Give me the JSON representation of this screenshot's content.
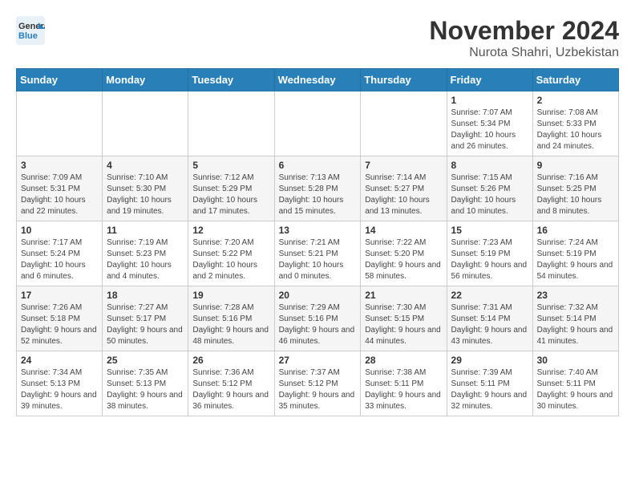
{
  "logo": {
    "line1": "General",
    "line2": "Blue"
  },
  "title": "November 2024",
  "location": "Nurota Shahri, Uzbekistan",
  "days_of_week": [
    "Sunday",
    "Monday",
    "Tuesday",
    "Wednesday",
    "Thursday",
    "Friday",
    "Saturday"
  ],
  "weeks": [
    [
      {
        "day": "",
        "info": ""
      },
      {
        "day": "",
        "info": ""
      },
      {
        "day": "",
        "info": ""
      },
      {
        "day": "",
        "info": ""
      },
      {
        "day": "",
        "info": ""
      },
      {
        "day": "1",
        "info": "Sunrise: 7:07 AM\nSunset: 5:34 PM\nDaylight: 10 hours and 26 minutes."
      },
      {
        "day": "2",
        "info": "Sunrise: 7:08 AM\nSunset: 5:33 PM\nDaylight: 10 hours and 24 minutes."
      }
    ],
    [
      {
        "day": "3",
        "info": "Sunrise: 7:09 AM\nSunset: 5:31 PM\nDaylight: 10 hours and 22 minutes."
      },
      {
        "day": "4",
        "info": "Sunrise: 7:10 AM\nSunset: 5:30 PM\nDaylight: 10 hours and 19 minutes."
      },
      {
        "day": "5",
        "info": "Sunrise: 7:12 AM\nSunset: 5:29 PM\nDaylight: 10 hours and 17 minutes."
      },
      {
        "day": "6",
        "info": "Sunrise: 7:13 AM\nSunset: 5:28 PM\nDaylight: 10 hours and 15 minutes."
      },
      {
        "day": "7",
        "info": "Sunrise: 7:14 AM\nSunset: 5:27 PM\nDaylight: 10 hours and 13 minutes."
      },
      {
        "day": "8",
        "info": "Sunrise: 7:15 AM\nSunset: 5:26 PM\nDaylight: 10 hours and 10 minutes."
      },
      {
        "day": "9",
        "info": "Sunrise: 7:16 AM\nSunset: 5:25 PM\nDaylight: 10 hours and 8 minutes."
      }
    ],
    [
      {
        "day": "10",
        "info": "Sunrise: 7:17 AM\nSunset: 5:24 PM\nDaylight: 10 hours and 6 minutes."
      },
      {
        "day": "11",
        "info": "Sunrise: 7:19 AM\nSunset: 5:23 PM\nDaylight: 10 hours and 4 minutes."
      },
      {
        "day": "12",
        "info": "Sunrise: 7:20 AM\nSunset: 5:22 PM\nDaylight: 10 hours and 2 minutes."
      },
      {
        "day": "13",
        "info": "Sunrise: 7:21 AM\nSunset: 5:21 PM\nDaylight: 10 hours and 0 minutes."
      },
      {
        "day": "14",
        "info": "Sunrise: 7:22 AM\nSunset: 5:20 PM\nDaylight: 9 hours and 58 minutes."
      },
      {
        "day": "15",
        "info": "Sunrise: 7:23 AM\nSunset: 5:19 PM\nDaylight: 9 hours and 56 minutes."
      },
      {
        "day": "16",
        "info": "Sunrise: 7:24 AM\nSunset: 5:19 PM\nDaylight: 9 hours and 54 minutes."
      }
    ],
    [
      {
        "day": "17",
        "info": "Sunrise: 7:26 AM\nSunset: 5:18 PM\nDaylight: 9 hours and 52 minutes."
      },
      {
        "day": "18",
        "info": "Sunrise: 7:27 AM\nSunset: 5:17 PM\nDaylight: 9 hours and 50 minutes."
      },
      {
        "day": "19",
        "info": "Sunrise: 7:28 AM\nSunset: 5:16 PM\nDaylight: 9 hours and 48 minutes."
      },
      {
        "day": "20",
        "info": "Sunrise: 7:29 AM\nSunset: 5:16 PM\nDaylight: 9 hours and 46 minutes."
      },
      {
        "day": "21",
        "info": "Sunrise: 7:30 AM\nSunset: 5:15 PM\nDaylight: 9 hours and 44 minutes."
      },
      {
        "day": "22",
        "info": "Sunrise: 7:31 AM\nSunset: 5:14 PM\nDaylight: 9 hours and 43 minutes."
      },
      {
        "day": "23",
        "info": "Sunrise: 7:32 AM\nSunset: 5:14 PM\nDaylight: 9 hours and 41 minutes."
      }
    ],
    [
      {
        "day": "24",
        "info": "Sunrise: 7:34 AM\nSunset: 5:13 PM\nDaylight: 9 hours and 39 minutes."
      },
      {
        "day": "25",
        "info": "Sunrise: 7:35 AM\nSunset: 5:13 PM\nDaylight: 9 hours and 38 minutes."
      },
      {
        "day": "26",
        "info": "Sunrise: 7:36 AM\nSunset: 5:12 PM\nDaylight: 9 hours and 36 minutes."
      },
      {
        "day": "27",
        "info": "Sunrise: 7:37 AM\nSunset: 5:12 PM\nDaylight: 9 hours and 35 minutes."
      },
      {
        "day": "28",
        "info": "Sunrise: 7:38 AM\nSunset: 5:11 PM\nDaylight: 9 hours and 33 minutes."
      },
      {
        "day": "29",
        "info": "Sunrise: 7:39 AM\nSunset: 5:11 PM\nDaylight: 9 hours and 32 minutes."
      },
      {
        "day": "30",
        "info": "Sunrise: 7:40 AM\nSunset: 5:11 PM\nDaylight: 9 hours and 30 minutes."
      }
    ]
  ]
}
